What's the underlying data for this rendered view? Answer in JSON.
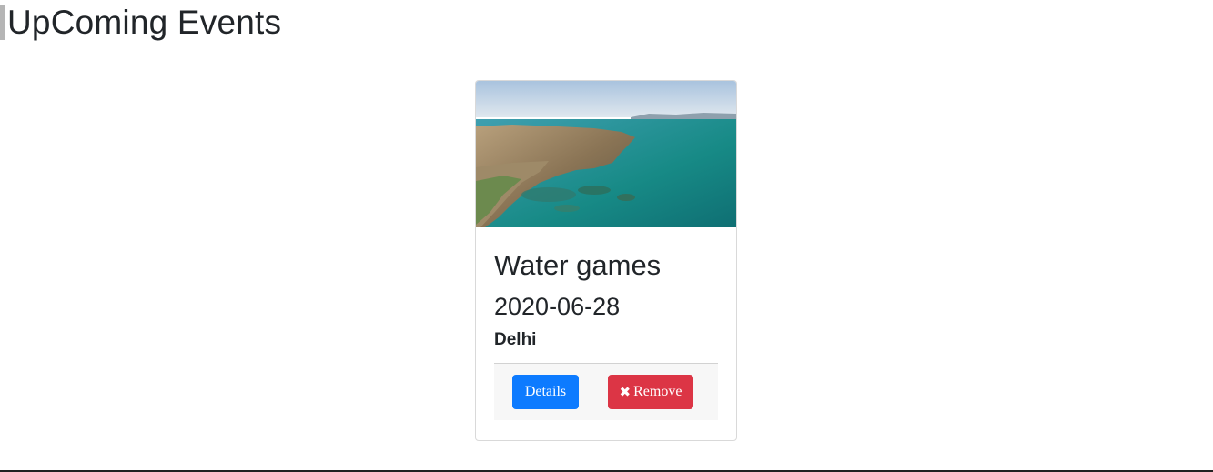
{
  "page": {
    "heading": "UpComing Events"
  },
  "event_card": {
    "image_alt": "Aerial view of coastline and turquoise water",
    "title": "Water games",
    "date": "2020-06-28",
    "location": "Delhi",
    "buttons": {
      "details_label": "Details",
      "remove_label": "Remove",
      "remove_icon": "✖"
    }
  },
  "colors": {
    "primary": "#0d7bff",
    "danger": "#dc3545",
    "text": "#212529"
  }
}
